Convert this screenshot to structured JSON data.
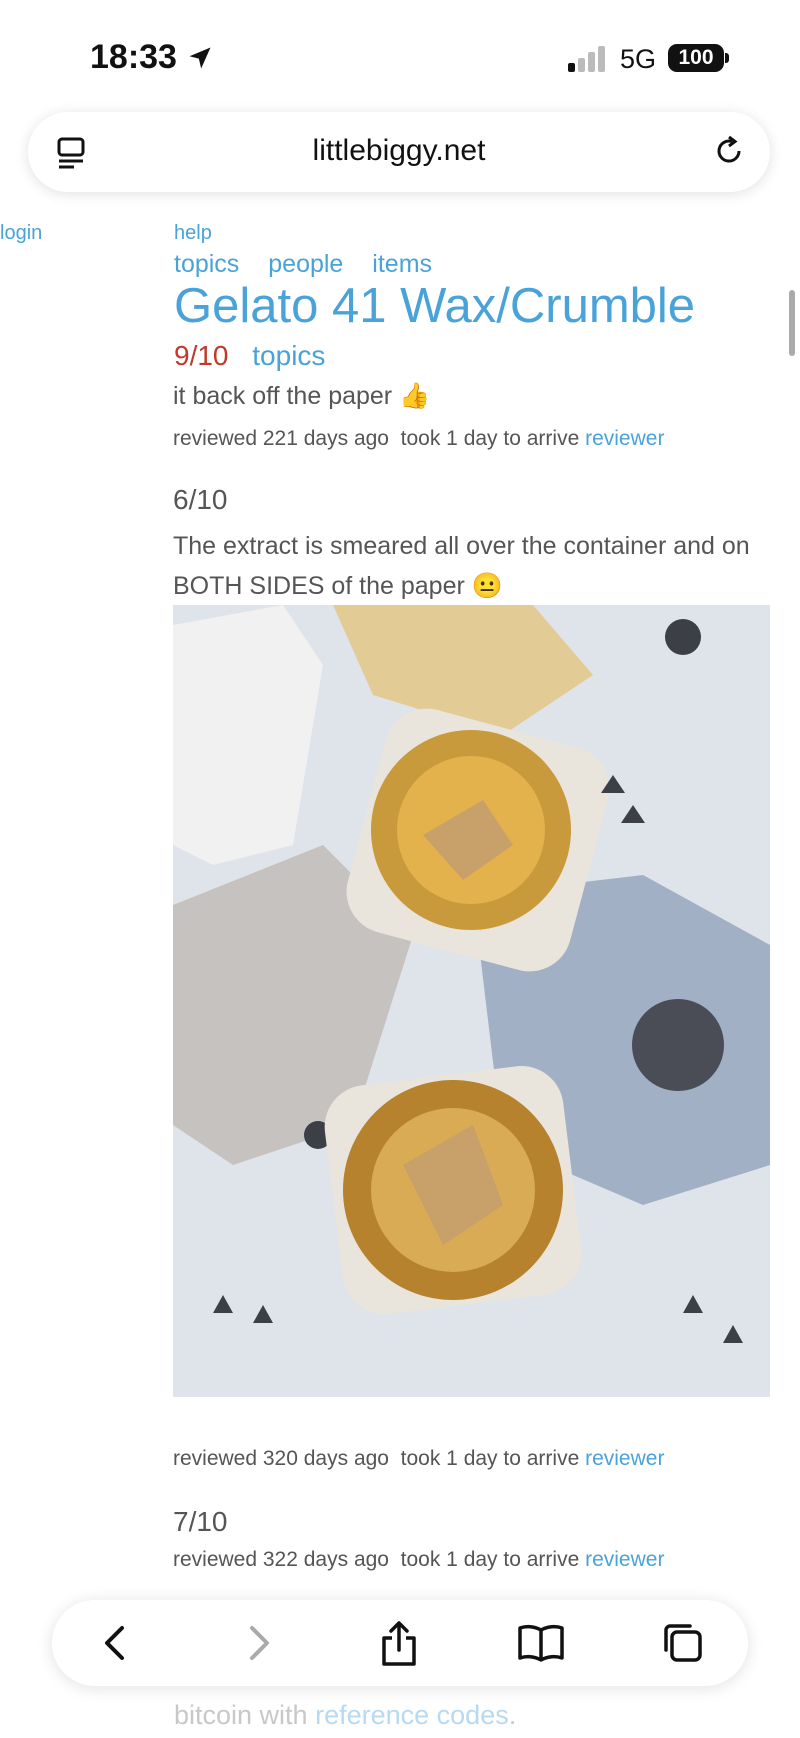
{
  "status_bar": {
    "time": "18:33",
    "network": "5G",
    "battery": "100"
  },
  "browser": {
    "url": "littlebiggy.net"
  },
  "page": {
    "login": "login",
    "help": "help",
    "nav": [
      "topics",
      "people",
      "items"
    ],
    "title": "Gelato 41 Wax/Crumble",
    "rating": "9/10",
    "rating_link": "topics",
    "review1": {
      "text": "it back off the paper 👍",
      "reviewed": "reviewed 221 days ago",
      "arrived": "took 1 day to arrive",
      "reviewer": "reviewer"
    },
    "review2": {
      "score": "6/10",
      "text": "The extract is smeared all over the container and on BOTH SIDES of the paper 😐",
      "reviewed": "reviewed 320 days ago",
      "arrived": "took 1 day to arrive",
      "reviewer": "reviewer"
    },
    "review3": {
      "score": "7/10",
      "reviewed": "reviewed 322 days ago",
      "arrived": "took 1 day to arrive",
      "reviewer": "reviewer"
    },
    "footer": {
      "text": "bitcoin with",
      "link": "reference codes",
      "suffix": "."
    }
  },
  "icons": {
    "back": "chevron-left-icon",
    "forward": "chevron-right-icon",
    "share": "share-icon",
    "bookmarks": "book-icon",
    "tabs": "tabs-icon"
  },
  "colors": {
    "link": "#4aa3d8",
    "rating": "#c0392b",
    "text": "#555555"
  }
}
